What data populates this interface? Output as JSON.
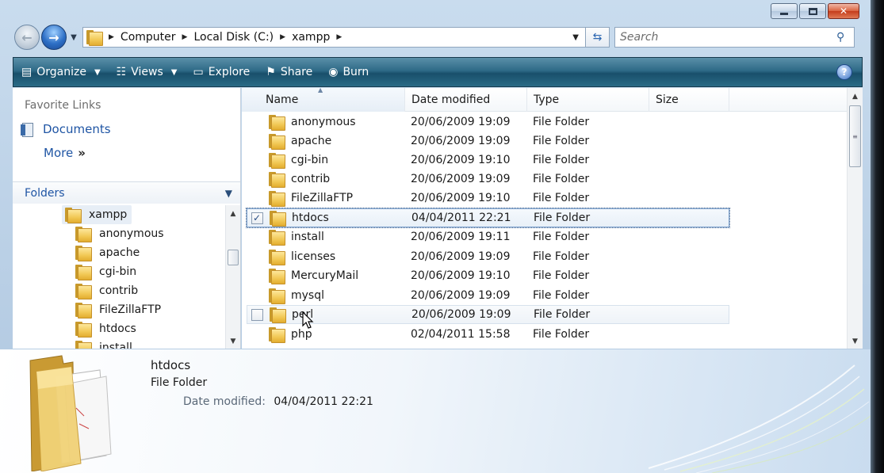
{
  "window": {
    "caption": {
      "minimize": "minimize",
      "maximize": "maximize",
      "close": "close"
    }
  },
  "address": {
    "breadcrumbs": [
      "Computer",
      "Local Disk (C:)",
      "xampp"
    ],
    "search_placeholder": "Search"
  },
  "toolbar": {
    "organize": "Organize",
    "views": "Views",
    "explore": "Explore",
    "share": "Share",
    "burn": "Burn",
    "help": "?"
  },
  "nav": {
    "favorite_header": "Favorite Links",
    "documents": "Documents",
    "more": "More",
    "folders_header": "Folders",
    "tree_root": "xampp",
    "tree_children": [
      "anonymous",
      "apache",
      "cgi-bin",
      "contrib",
      "FileZillaFTP",
      "htdocs",
      "install"
    ]
  },
  "list": {
    "columns": {
      "name": "Name",
      "date": "Date modified",
      "type": "Type",
      "size": "Size"
    },
    "rows": [
      {
        "name": "anonymous",
        "date": "20/06/2009 19:09",
        "type": "File Folder"
      },
      {
        "name": "apache",
        "date": "20/06/2009 19:09",
        "type": "File Folder"
      },
      {
        "name": "cgi-bin",
        "date": "20/06/2009 19:10",
        "type": "File Folder"
      },
      {
        "name": "contrib",
        "date": "20/06/2009 19:09",
        "type": "File Folder"
      },
      {
        "name": "FileZillaFTP",
        "date": "20/06/2009 19:10",
        "type": "File Folder"
      },
      {
        "name": "htdocs",
        "date": "04/04/2011 22:21",
        "type": "File Folder",
        "selected": true
      },
      {
        "name": "install",
        "date": "20/06/2009 19:11",
        "type": "File Folder"
      },
      {
        "name": "licenses",
        "date": "20/06/2009 19:09",
        "type": "File Folder"
      },
      {
        "name": "MercuryMail",
        "date": "20/06/2009 19:10",
        "type": "File Folder"
      },
      {
        "name": "mysql",
        "date": "20/06/2009 19:09",
        "type": "File Folder"
      },
      {
        "name": "perl",
        "date": "20/06/2009 19:09",
        "type": "File Folder",
        "hover": true
      },
      {
        "name": "php",
        "date": "02/04/2011 15:58",
        "type": "File Folder"
      }
    ]
  },
  "details": {
    "name": "htdocs",
    "type": "File Folder",
    "date_label": "Date modified:",
    "date_value": "04/04/2011 22:21"
  },
  "colors": {
    "command_bar": "#2e6a87",
    "link_blue": "#1f55a4",
    "selection_border": "#7da2ce"
  }
}
